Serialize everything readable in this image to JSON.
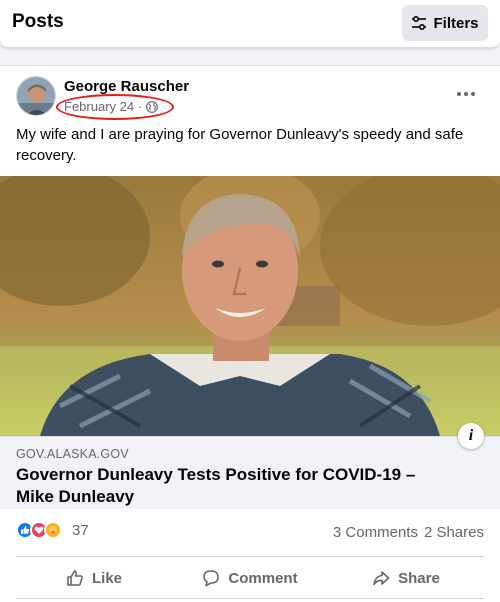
{
  "header": {
    "title": "Posts",
    "filters_label": "Filters"
  },
  "post": {
    "author": "George Rauscher",
    "date": "February 24",
    "separator": "·",
    "privacy_icon": "globe-icon",
    "more_icon": "more-options-icon",
    "text": "My wife and I are praying for Governor Dunleavy's speedy and safe recovery."
  },
  "link": {
    "domain": "GOV.ALASKA.GOV",
    "title": "Governor Dunleavy Tests Positive for COVID-19 – Mike Dunleavy",
    "info_label": "i"
  },
  "engagement": {
    "reactions": [
      "like",
      "love",
      "care"
    ],
    "reaction_count": "37",
    "comments": "3 Comments",
    "shares": "2 Shares"
  },
  "actions": {
    "like": "Like",
    "comment": "Comment",
    "share": "Share"
  },
  "colors": {
    "accent": "#1877f2",
    "highlight": "#e41b17",
    "secondary_text": "#65676b"
  }
}
